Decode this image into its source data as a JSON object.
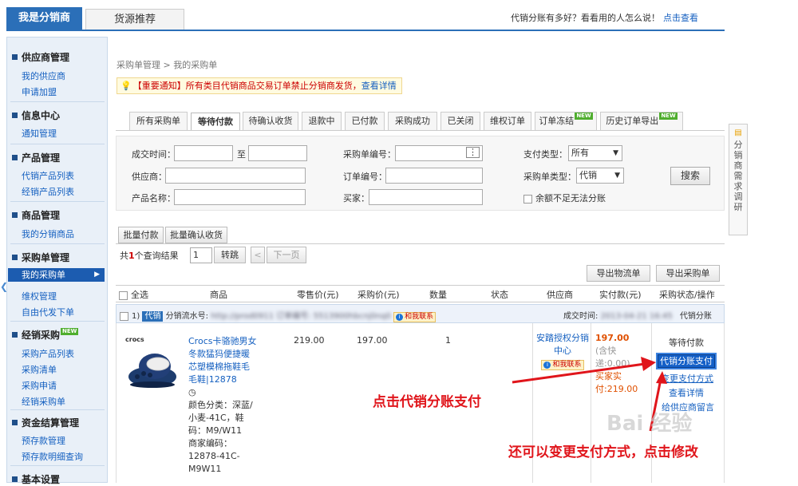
{
  "top_tabs": [
    "我是分销商",
    "货源推荐"
  ],
  "top_right": {
    "text": "代销分账有多好？看看用的人怎么说！",
    "link": "点击查看"
  },
  "sidebar": [
    {
      "title": "供应商管理",
      "links": [
        "我的供应商",
        "申请加盟"
      ]
    },
    {
      "title": "信息中心",
      "links": [
        "通知管理"
      ]
    },
    {
      "title": "产品管理",
      "links": [
        "代销产品列表",
        "经销产品列表"
      ]
    },
    {
      "title": "商品管理",
      "links": [
        "我的分销商品"
      ]
    },
    {
      "title": "采购单管理",
      "links": [
        "我的采购单",
        "维权管理",
        "自由代发下单"
      ]
    },
    {
      "title": "经销采购",
      "badge": "NEW",
      "links": [
        "采购产品列表",
        "采购清单",
        "采购申请",
        "经销采购单"
      ]
    },
    {
      "title": "资金结算管理",
      "links": [
        "预存款管理",
        "预存款明细查询"
      ]
    },
    {
      "title": "基本设置",
      "links": []
    }
  ],
  "breadcrumb": "采购单管理 > 我的采购单",
  "notice": {
    "prefix": "【重要通知】所有类目代销商品交易订单禁止分销商发货，",
    "link": "查看详情"
  },
  "order_tabs": [
    "所有采购单",
    "等待付款",
    "待确认收货",
    "退款中",
    "已付款",
    "采购成功",
    "已关闭",
    "维权订单",
    "订单冻结",
    "历史订单导出"
  ],
  "new_badge": "NEW",
  "form": {
    "deal_time": "成交时间：",
    "to": "至",
    "po_no": "采购单编号：",
    "pay_type": "支付类型：",
    "pay_type_value": "所有",
    "supplier": "供应商：",
    "order_no": "订单编号：",
    "po_type": "采购单类型：",
    "po_type_value": "代销",
    "product_name": "产品名称：",
    "buyer": "买家：",
    "balance_check": "余额不足无法分账",
    "search": "搜索"
  },
  "batch": {
    "pay": "批量付款",
    "confirm": "批量确认收货"
  },
  "paging": {
    "prefix": "共",
    "count": "1",
    "suffix": "个查询结果",
    "page": "1",
    "go": "转跳",
    "prev": "<",
    "next": "下一页"
  },
  "export": {
    "logistics": "导出物流单",
    "po": "导出采购单"
  },
  "table_headers": [
    "全选",
    "商品",
    "零售价(元)",
    "采购价(元)",
    "数量",
    "状态",
    "供应商",
    "实付款(元)",
    "采购状态/操作"
  ],
  "order_header": {
    "index": "1)",
    "tag": "代销",
    "serial_label": "分销流水号:",
    "serial_value": "http://prod0911 订单编号: 5513900hbcnj0nq0",
    "contact": "和我联系",
    "deal_time_label": "成交时间:",
    "deal_time_value": "2013-04-21 16:45",
    "type": "代销分账"
  },
  "order": {
    "brand": "crocs",
    "title": "Crocs卡骆驰男女 冬款猛犸便捷暖芯塑模棉拖鞋毛毛鞋|12878",
    "clock": "◷",
    "attrs": "颜色分类：深蓝/小麦-41C，鞋码：M9/W11",
    "merchant_code": "商家编码：12878-41C-M9W11",
    "retail_price": "219.00",
    "purchase_price": "197.00",
    "qty": "1",
    "supplier": "安踏授权分销中心",
    "supplier_contact": "和我联系",
    "paid": "197.00",
    "shipping": "(含快递:0.00)",
    "buyer_paid_label": "买家实",
    "buyer_paid_value": "付:219.00",
    "status": "等待付款",
    "pay_btn": "代销分账支付",
    "change_pay": "变更支付方式",
    "detail": "查看详情",
    "message": "给供应商留言"
  },
  "float_panel": "分销商需求调研",
  "annotations": {
    "a1": "点击代销分账支付",
    "a2": "还可以变更支付方式，点击修改"
  },
  "watermark": "Bai 经验"
}
